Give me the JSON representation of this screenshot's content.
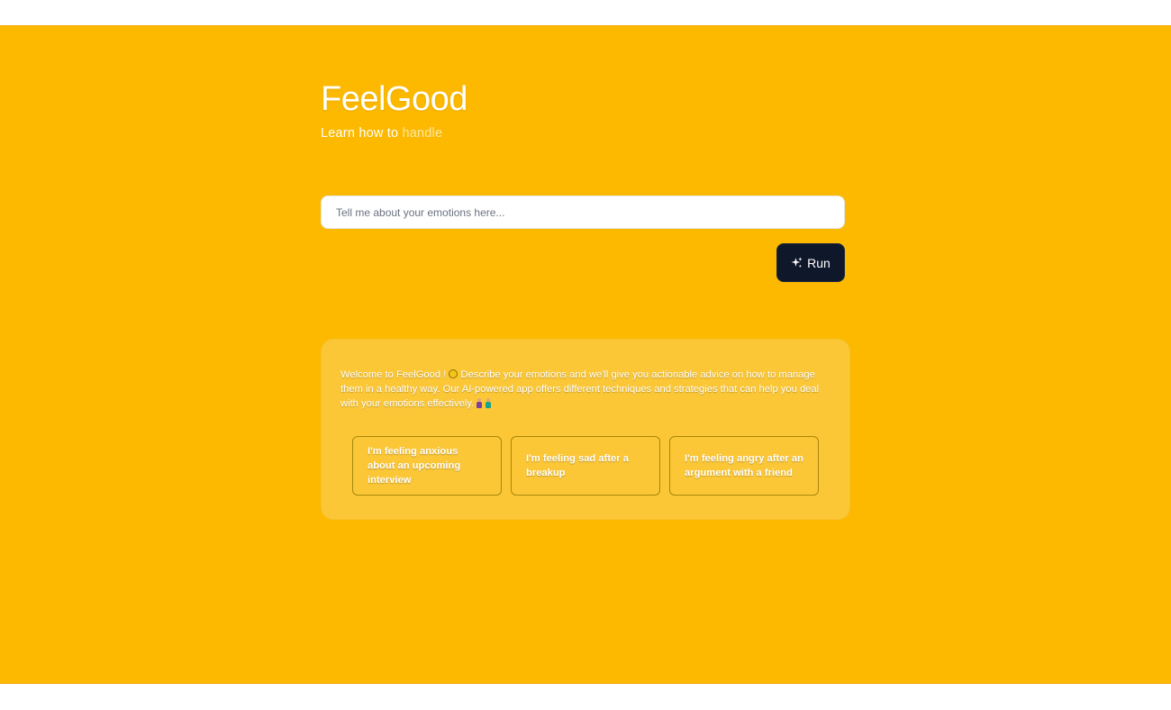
{
  "app": {
    "title": "FeelGood",
    "subtitle_prefix": "Learn how to",
    "subtitle_accent": "handle"
  },
  "colors": {
    "background": "#fcb900",
    "card": "#fbc737",
    "run_button": "#0f172a"
  },
  "prompt": {
    "value": "",
    "placeholder": "Tell me about your emotions here..."
  },
  "run_button": {
    "label": "Run",
    "icon": "sparkles-icon"
  },
  "welcome": {
    "part1": "Welcome to FeelGood !",
    "emoji1": "smiling-face-emoji",
    "part2": "Describe your emotions and we'll give you actionable advice on how to manage them in a healthy way. Our AI-powered app offers different techniques and strategies that can help you deal with your emotions effectively.",
    "emoji2": "people-emoji"
  },
  "suggestions": [
    "I'm feeling anxious about an upcoming interview",
    "I'm feeling sad after a breakup",
    "I'm feeling angry after an argument with a friend"
  ]
}
